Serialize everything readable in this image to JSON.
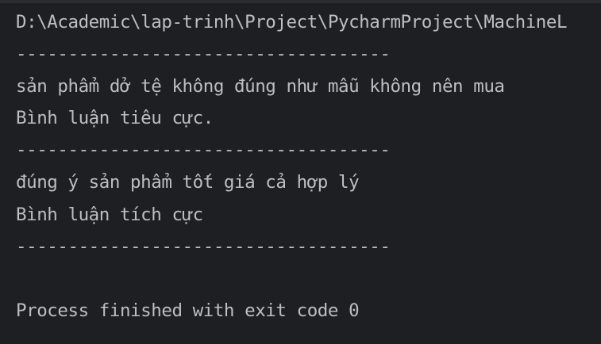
{
  "console": {
    "lines": [
      "D:\\Academic\\lap-trinh\\Project\\PycharmProject\\MachineL",
      "------------------------------------",
      "sản phẩm dở tệ không đúng như mẫu không nên mua",
      "Bình luận tiêu cực.",
      "------------------------------------",
      "đúng ý sản phẩm tốt giá cả hợp lý",
      "Bình luận tích cực",
      "------------------------------------",
      "",
      "Process finished with exit code 0"
    ],
    "colors": {
      "background": "#1e1f22",
      "text": "#bcbec4"
    }
  }
}
